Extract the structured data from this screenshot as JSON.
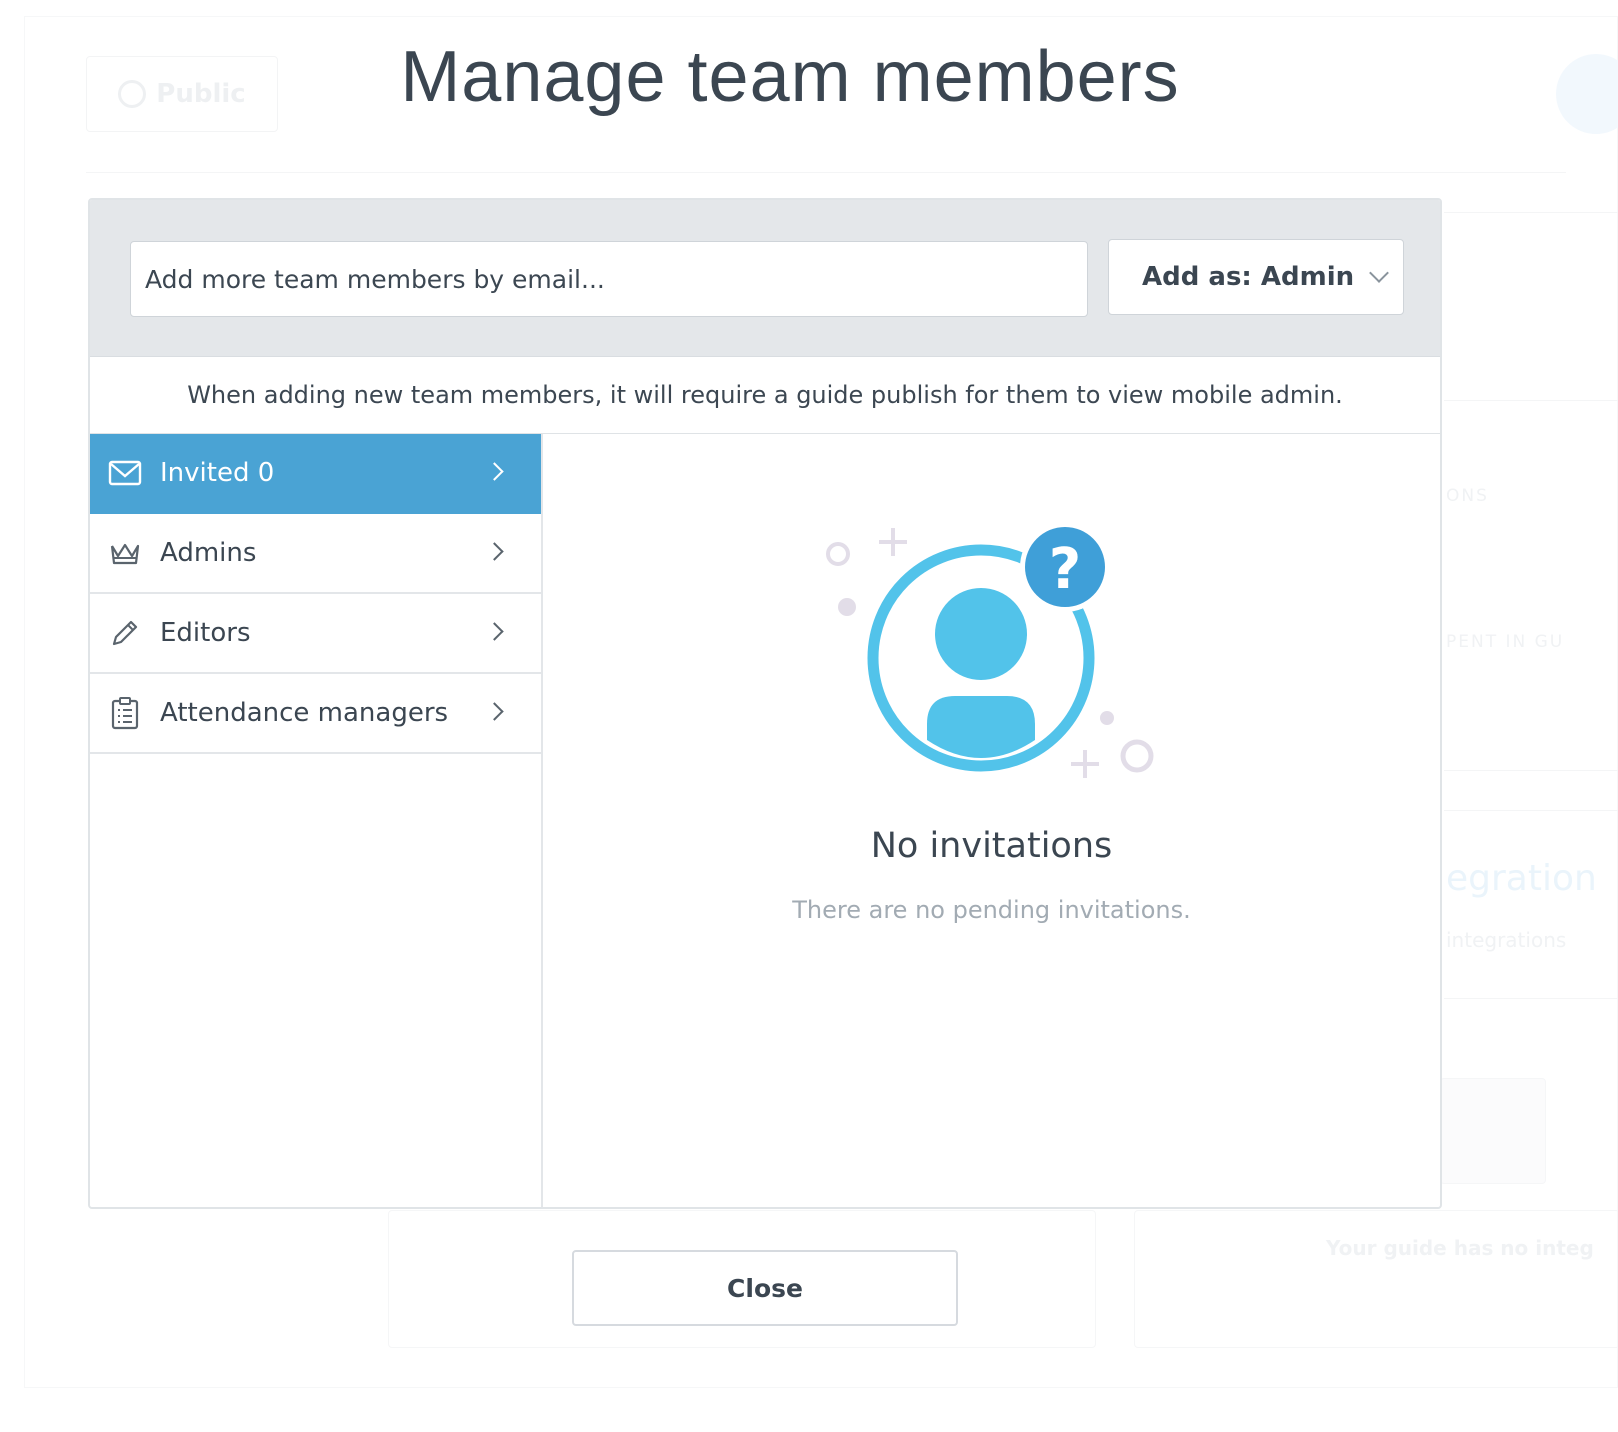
{
  "page_title": "Manage team members",
  "background": {
    "public_label": "Public",
    "section_text_1": "ONS",
    "section_text_2": "PENT IN GU",
    "integrations_title": "egration",
    "integrations_sub": "integrations",
    "empty_note": "Your guide has no integ"
  },
  "invite": {
    "email_placeholder": "Add more team members by email...",
    "role_label": "Add as: Admin"
  },
  "notice": "When adding new team members, it will require a guide publish for them to view mobile admin.",
  "sidebar": {
    "items": [
      {
        "label": "Invited 0",
        "icon": "envelope-icon",
        "active": true
      },
      {
        "label": "Admins",
        "icon": "crown-icon"
      },
      {
        "label": "Editors",
        "icon": "pencil-icon"
      },
      {
        "label": "Attendance managers",
        "icon": "clipboard-icon"
      }
    ]
  },
  "empty_state": {
    "title": "No invitations",
    "subtitle": "There are no pending invitations.",
    "badge_glyph": "?"
  },
  "footer": {
    "close_label": "Close"
  },
  "colors": {
    "accent": "#4aa3d4",
    "illustration": "#52c3ea",
    "badge": "#3f9fd8"
  }
}
